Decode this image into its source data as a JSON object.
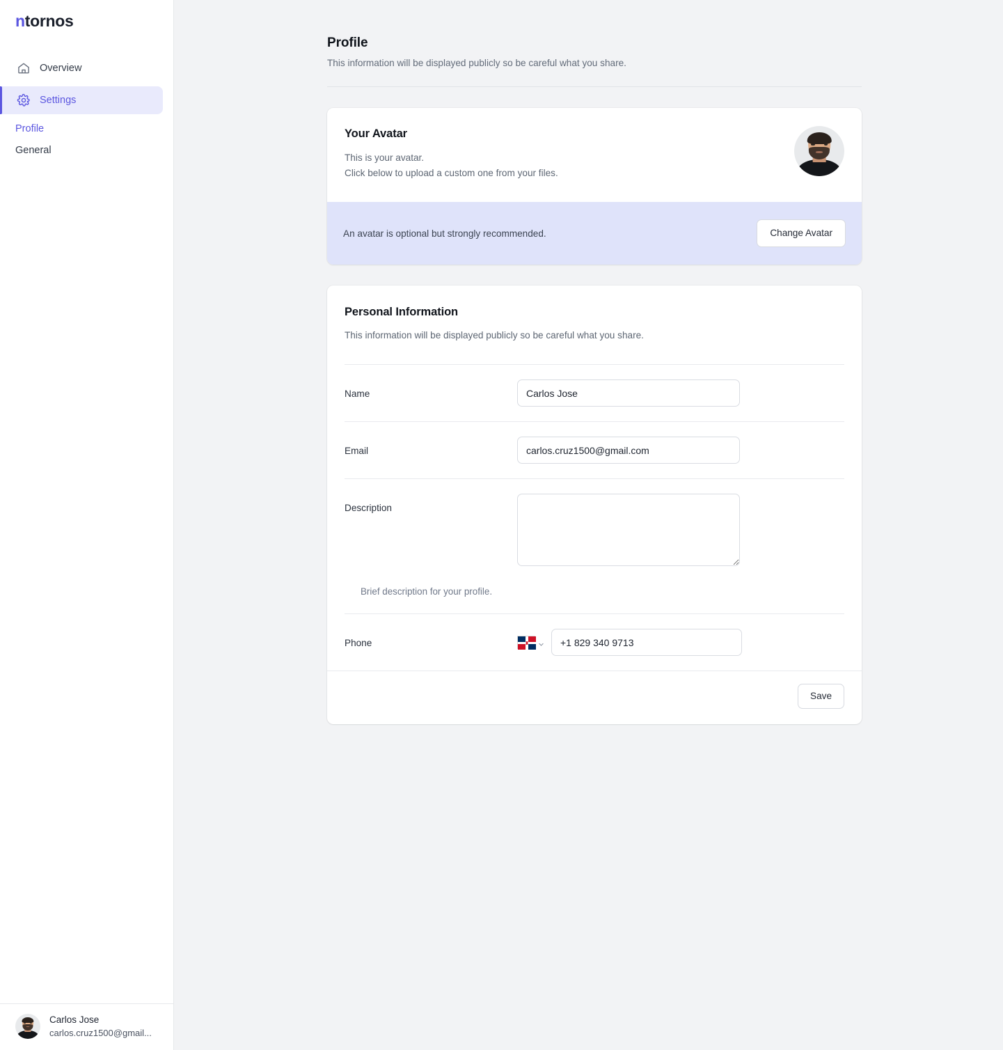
{
  "brand": {
    "accent_text": "n",
    "rest_text": "tornos",
    "accent_color": "#5b56e0"
  },
  "sidebar": {
    "nav_items": [
      {
        "label": "Overview",
        "icon": "home-icon",
        "active": false
      },
      {
        "label": "Settings",
        "icon": "gear-icon",
        "active": true
      }
    ],
    "sub_items": [
      {
        "label": "Profile",
        "active": true
      },
      {
        "label": "General",
        "active": false
      }
    ],
    "user": {
      "name": "Carlos Jose",
      "email": "carlos.cruz1500@gmail...",
      "avatar_icon": "user-avatar-photo"
    }
  },
  "header": {
    "title": "Profile",
    "subtitle": "This information will be displayed publicly so be careful what you share."
  },
  "avatar_card": {
    "heading": "Your Avatar",
    "line_1": "This is your avatar.",
    "line_2": "Click below to upload a custom one from your files.",
    "footer_note": "An avatar is optional but strongly recommended.",
    "change_button": "Change Avatar",
    "footer_bg": "#dfe3fa"
  },
  "personal_information": {
    "heading": "Personal Information",
    "subheading": "This information will be displayed publicly so be careful what you share.",
    "fields": {
      "name": {
        "label": "Name",
        "value": "Carlos Jose",
        "placeholder": "Your name"
      },
      "email": {
        "label": "Email",
        "value": "carlos.cruz1500@gmail.com",
        "placeholder": "Your email"
      },
      "description": {
        "label": "Description",
        "value": "",
        "placeholder": "",
        "help": "Brief description for your profile."
      },
      "phone": {
        "label": "Phone",
        "value": "+1 829 340 9713",
        "placeholder": "Your phone",
        "country_flag": "dominican-republic-flag-icon",
        "country_chevron": "chevron-down-icon"
      }
    },
    "save_button": "Save"
  }
}
